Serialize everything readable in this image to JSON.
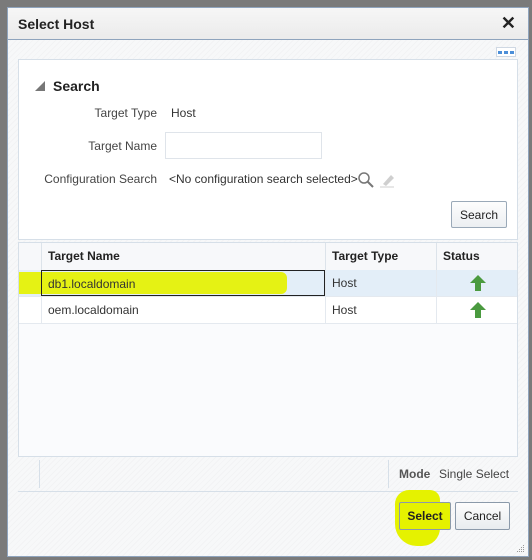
{
  "dialog": {
    "title": "Select Host",
    "close_icon": "close-icon",
    "more_icon": "more-options-icon"
  },
  "search": {
    "header": "Search",
    "fields": {
      "target_type_label": "Target Type",
      "target_type_value": "Host",
      "target_name_label": "Target Name",
      "target_name_value": "",
      "config_search_label": "Configuration Search",
      "config_search_value": "<No configuration search selected>"
    },
    "search_button": "Search"
  },
  "table": {
    "columns": [
      "Target Name",
      "Target Type",
      "Status"
    ],
    "rows": [
      {
        "name": "db1.localdomain",
        "type": "Host",
        "status": "up",
        "selected": true
      },
      {
        "name": "oem.localdomain",
        "type": "Host",
        "status": "up",
        "selected": false
      }
    ]
  },
  "footer": {
    "mode_label": "Mode",
    "mode_value": "Single Select"
  },
  "buttons": {
    "select": "Select",
    "cancel": "Cancel"
  },
  "colors": {
    "highlight": "#e5f200",
    "status_up": "#4a9a3f",
    "selected_row": "#e3eef8"
  }
}
